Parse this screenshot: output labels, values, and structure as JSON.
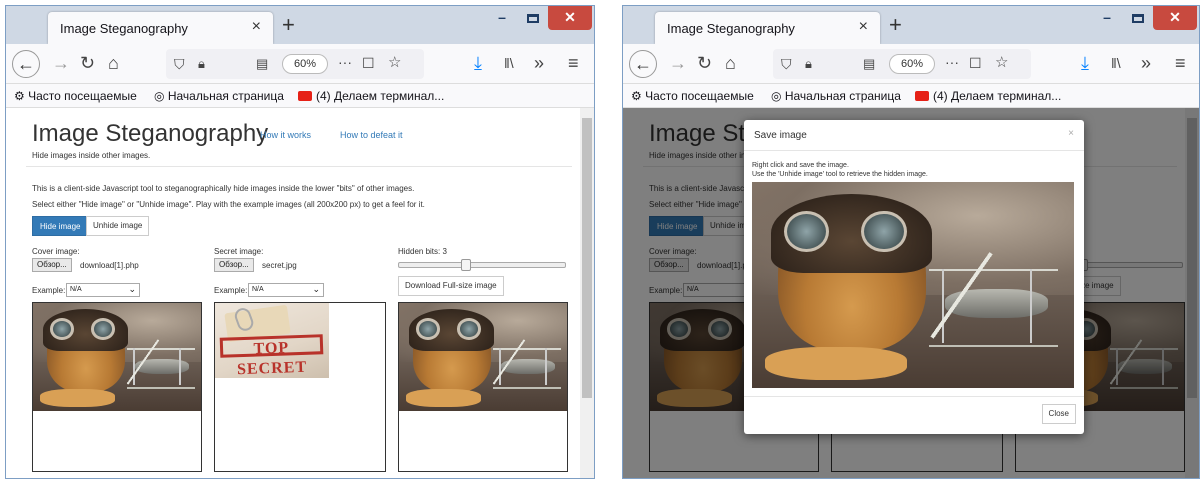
{
  "browser": {
    "tab_title": "Image Steganography",
    "tab_close": "×",
    "new_tab": "+",
    "zoom": "60%",
    "bookmarks": [
      "Часто посещаемые",
      "Начальная страница",
      "(4) Делаем терминал..."
    ]
  },
  "page": {
    "title": "Image Steganography",
    "link_how": "How it works",
    "link_defeat": "How to defeat it",
    "subtitle": "Hide images inside other images.",
    "intro": "This is a client-side Javascript tool to steganographically hide images inside the lower \"bits\" of other images.",
    "select_text": "Select either \"Hide image\" or \"Unhide image\". Play with the example images (all 200x200 px) to get a feel for it.",
    "hide_btn": "Hide image",
    "unhide_btn": "Unhide image",
    "cover_label": "Cover image:",
    "browse": "Обзор...",
    "cover_file": "download[1].php",
    "secret_label": "Secret image:",
    "secret_file": "secret.jpg",
    "hidden_bits": "Hidden bits: 3",
    "download_btn": "Download Full-size image",
    "example_label": "Example:",
    "example_value": "N/A",
    "secret_stamp": "TOP SECRET"
  },
  "slider": {
    "hidden_bits": 3,
    "max_bits": 8
  },
  "modal": {
    "title": "Save image",
    "close_x": "×",
    "line1": "Right click and save the image.",
    "line2": "Use the 'Unhide image' tool to retrieve the hidden image.",
    "close_btn": "Close"
  }
}
